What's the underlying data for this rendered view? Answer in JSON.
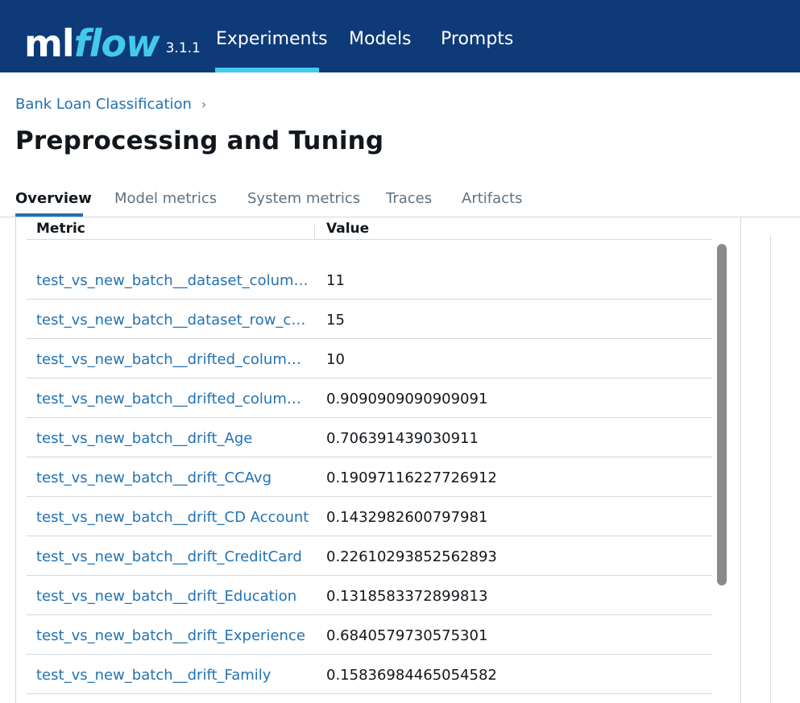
{
  "app": {
    "logo_ml": "ml",
    "logo_flow": "flow",
    "version": "3.1.1",
    "brand_color": "#0e3a78",
    "accent_color": "#43c9ed"
  },
  "nav": {
    "items": [
      {
        "label": "Experiments",
        "active": true
      },
      {
        "label": "Models",
        "active": false
      },
      {
        "label": "Prompts",
        "active": false
      }
    ]
  },
  "breadcrumb": {
    "experiment": "Bank Loan Classification",
    "separator": "›"
  },
  "page": {
    "title": "Preprocessing and Tuning"
  },
  "tabs": [
    {
      "label": "Overview",
      "active": true
    },
    {
      "label": "Model metrics",
      "active": false
    },
    {
      "label": "System metrics",
      "active": false
    },
    {
      "label": "Traces",
      "active": false
    },
    {
      "label": "Artifacts",
      "active": false
    }
  ],
  "metrics_table": {
    "columns": [
      "Metric",
      "Value"
    ],
    "rows": [
      {
        "metric": "test_vs_new_batch__dataset_column_count",
        "display": "test_vs_new_batch__dataset_column_…",
        "value": "11"
      },
      {
        "metric": "test_vs_new_batch__dataset_row_count",
        "display": "test_vs_new_batch__dataset_row_count",
        "value": "15"
      },
      {
        "metric": "test_vs_new_batch__drifted_columns_count",
        "display": "test_vs_new_batch__drifted_columns_…",
        "value": "10"
      },
      {
        "metric": "test_vs_new_batch__drifted_columns_share",
        "display": "test_vs_new_batch__drifted_columns_…",
        "value": "0.9090909090909091"
      },
      {
        "metric": "test_vs_new_batch__drift_Age",
        "display": "test_vs_new_batch__drift_Age",
        "value": "0.706391439030911"
      },
      {
        "metric": "test_vs_new_batch__drift_CCAvg",
        "display": "test_vs_new_batch__drift_CCAvg",
        "value": "0.19097116227726912"
      },
      {
        "metric": "test_vs_new_batch__drift_CD Account",
        "display": "test_vs_new_batch__drift_CD Account",
        "value": "0.1432982600797981"
      },
      {
        "metric": "test_vs_new_batch__drift_CreditCard",
        "display": "test_vs_new_batch__drift_CreditCard",
        "value": "0.22610293852562893"
      },
      {
        "metric": "test_vs_new_batch__drift_Education",
        "display": "test_vs_new_batch__drift_Education",
        "value": "0.1318583372899813"
      },
      {
        "metric": "test_vs_new_batch__drift_Experience",
        "display": "test_vs_new_batch__drift_Experience",
        "value": "0.6840579730575301"
      },
      {
        "metric": "test_vs_new_batch__drift_Family",
        "display": "test_vs_new_batch__drift_Family",
        "value": "0.15836984465054582"
      }
    ]
  }
}
